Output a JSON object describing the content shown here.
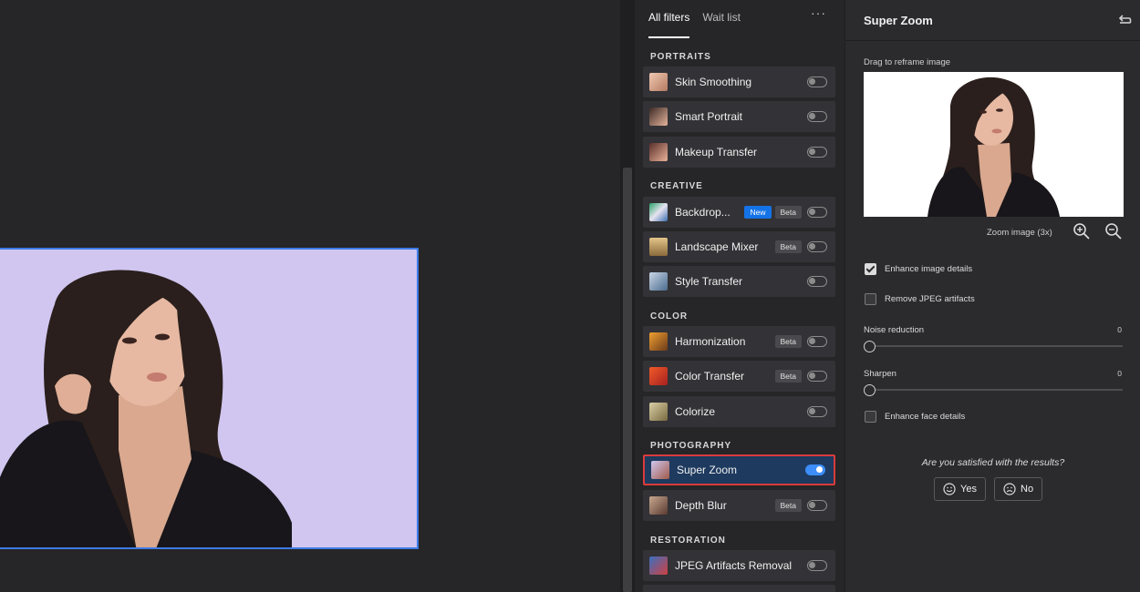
{
  "tabs": [
    {
      "label": "All filters",
      "active": true
    },
    {
      "label": "Wait list",
      "active": false
    }
  ],
  "more_label": "···",
  "sections": {
    "portraits": "PORTRAITS",
    "creative": "CREATIVE",
    "color": "COLOR",
    "photography": "PHOTOGRAPHY",
    "restoration": "RESTORATION"
  },
  "filters": {
    "skin_smoothing": {
      "label": "Skin Smoothing",
      "on": false
    },
    "smart_portrait": {
      "label": "Smart Portrait",
      "on": false
    },
    "makeup_transfer": {
      "label": "Makeup Transfer",
      "on": false
    },
    "backdrop": {
      "label": "Backdrop...",
      "new_badge": "New",
      "beta_badge": "Beta",
      "on": false
    },
    "landscape_mixer": {
      "label": "Landscape Mixer",
      "beta_badge": "Beta",
      "on": false
    },
    "style_transfer": {
      "label": "Style Transfer",
      "on": false
    },
    "harmonization": {
      "label": "Harmonization",
      "beta_badge": "Beta",
      "on": false
    },
    "color_transfer": {
      "label": "Color Transfer",
      "beta_badge": "Beta",
      "on": false
    },
    "colorize": {
      "label": "Colorize",
      "on": false
    },
    "super_zoom": {
      "label": "Super Zoom",
      "on": true,
      "selected": true
    },
    "depth_blur": {
      "label": "Depth Blur",
      "beta_badge": "Beta",
      "on": false
    },
    "jpeg_artifacts_removal": {
      "label": "JPEG Artifacts Removal",
      "on": false
    }
  },
  "settings": {
    "title": "Super Zoom",
    "drag_label": "Drag to reframe image",
    "zoom_label": "Zoom image (3x)",
    "enhance_details": {
      "label": "Enhance image details",
      "checked": true
    },
    "remove_jpeg": {
      "label": "Remove JPEG artifacts",
      "checked": false
    },
    "noise_reduction": {
      "label": "Noise reduction",
      "value": "0"
    },
    "sharpen": {
      "label": "Sharpen",
      "value": "0"
    },
    "enhance_face": {
      "label": "Enhance face details",
      "checked": false
    },
    "question": "Are you satisfied with the results?",
    "yes_label": "Yes",
    "no_label": "No"
  },
  "colors": {
    "accent": "#1473e6",
    "canvas_bg": "#d0c6f0",
    "selection_border": "#d93b3b"
  }
}
